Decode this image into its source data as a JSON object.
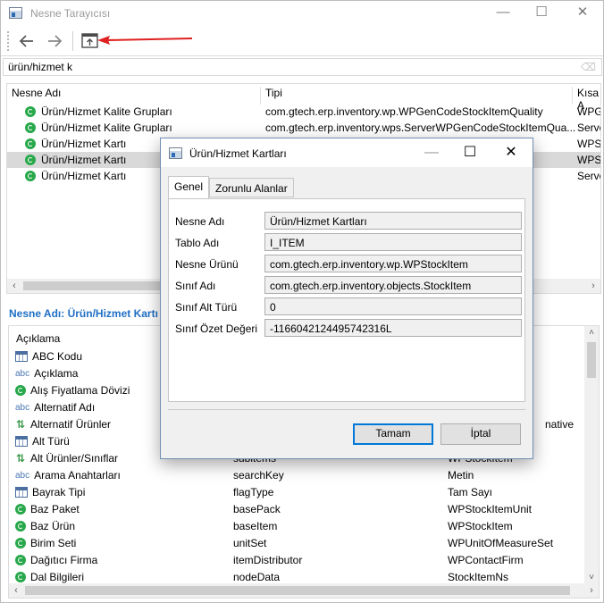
{
  "window": {
    "title": "Nesne Tarayıcısı",
    "minimize": "—",
    "maximize": "☐",
    "close": "✕"
  },
  "search": {
    "value": "ürün/hizmet k"
  },
  "top_table": {
    "columns": [
      "Nesne Adı",
      "Tipi",
      "Kısa A"
    ],
    "rows": [
      {
        "name": "Ürün/Hizmet Kalite Grupları",
        "type": "com.gtech.erp.inventory.wp.WPGenCodeStockItemQuality",
        "short": "WPGe"
      },
      {
        "name": "Ürün/Hizmet Kalite Grupları",
        "type": "com.gtech.erp.inventory.wps.ServerWPGenCodeStockItemQua...",
        "short": "Serve"
      },
      {
        "name": "Ürün/Hizmet Kartı",
        "type": "",
        "short": "WPSt"
      },
      {
        "name": "Ürün/Hizmet Kartı",
        "type": "",
        "short": "WPSt"
      },
      {
        "name": "Ürün/Hizmet Kartı",
        "type": "",
        "short": "Serve"
      }
    ]
  },
  "section": {
    "title": "Nesne Adı: Ürün/Hizmet Kartı"
  },
  "bottom_table": {
    "header": "Açıklama",
    "rows": [
      {
        "icon": "table-icon",
        "name": "ABC Kodu",
        "field": "",
        "type": ""
      },
      {
        "icon": "abc-icon",
        "name": "Açıklama",
        "field": "",
        "type": ""
      },
      {
        "icon": "object-icon",
        "name": "Alış Fiyatlama Dövizi",
        "field": "",
        "type": ""
      },
      {
        "icon": "abc-icon",
        "name": "Alternatif Adı",
        "field": "",
        "type": ""
      },
      {
        "icon": "relation-icon",
        "name": "Alternatif Ürünler",
        "field": "",
        "type": "native"
      },
      {
        "icon": "table-icon",
        "name": "Alt Türü",
        "field": "",
        "type": ""
      },
      {
        "icon": "relation-icon",
        "name": "Alt Ürünler/Sınıflar",
        "field": "subitems",
        "type": "WPStockItem"
      },
      {
        "icon": "abc-icon",
        "name": "Arama Anahtarları",
        "field": "searchKey",
        "type": "Metin"
      },
      {
        "icon": "table-icon",
        "name": "Bayrak Tipi",
        "field": "flagType",
        "type": "Tam Sayı"
      },
      {
        "icon": "object-icon",
        "name": "Baz Paket",
        "field": "basePack",
        "type": "WPStockItemUnit"
      },
      {
        "icon": "object-icon",
        "name": "Baz Ürün",
        "field": "baseItem",
        "type": "WPStockItem"
      },
      {
        "icon": "object-icon",
        "name": "Birim Seti",
        "field": "unitSet",
        "type": "WPUnitOfMeasureSet"
      },
      {
        "icon": "object-icon",
        "name": "Dağıtıcı Firma",
        "field": "itemDistributor",
        "type": "WPContactFirm"
      },
      {
        "icon": "object-icon",
        "name": "Dal Bilgileri",
        "field": "nodeData",
        "type": "StockItemNs"
      }
    ]
  },
  "dialog": {
    "title": "Ürün/Hizmet Kartları",
    "minimize": "—",
    "maximize": "☐",
    "close": "✕",
    "tabs": [
      "Genel",
      "Zorunlu Alanlar"
    ],
    "fields": [
      {
        "label": "Nesne Adı",
        "value": "Ürün/Hizmet Kartları"
      },
      {
        "label": "Tablo Adı",
        "value": "I_ITEM"
      },
      {
        "label": "Nesne Ürünü",
        "value": "com.gtech.erp.inventory.wp.WPStockItem"
      },
      {
        "label": "Sınıf Adı",
        "value": "com.gtech.erp.inventory.objects.StockItem"
      },
      {
        "label": "Sınıf Alt Türü",
        "value": "0"
      },
      {
        "label": "Sınıf Özet Değeri",
        "value": "-1166042124495742316L"
      }
    ],
    "ok_label": "Tamam",
    "cancel_label": "İptal"
  },
  "colors": {
    "accent": "#1f6fc5",
    "selected_row": "#d9d9d9",
    "annotation_arrow": "#e02020",
    "icon_green": "#27a84a"
  }
}
